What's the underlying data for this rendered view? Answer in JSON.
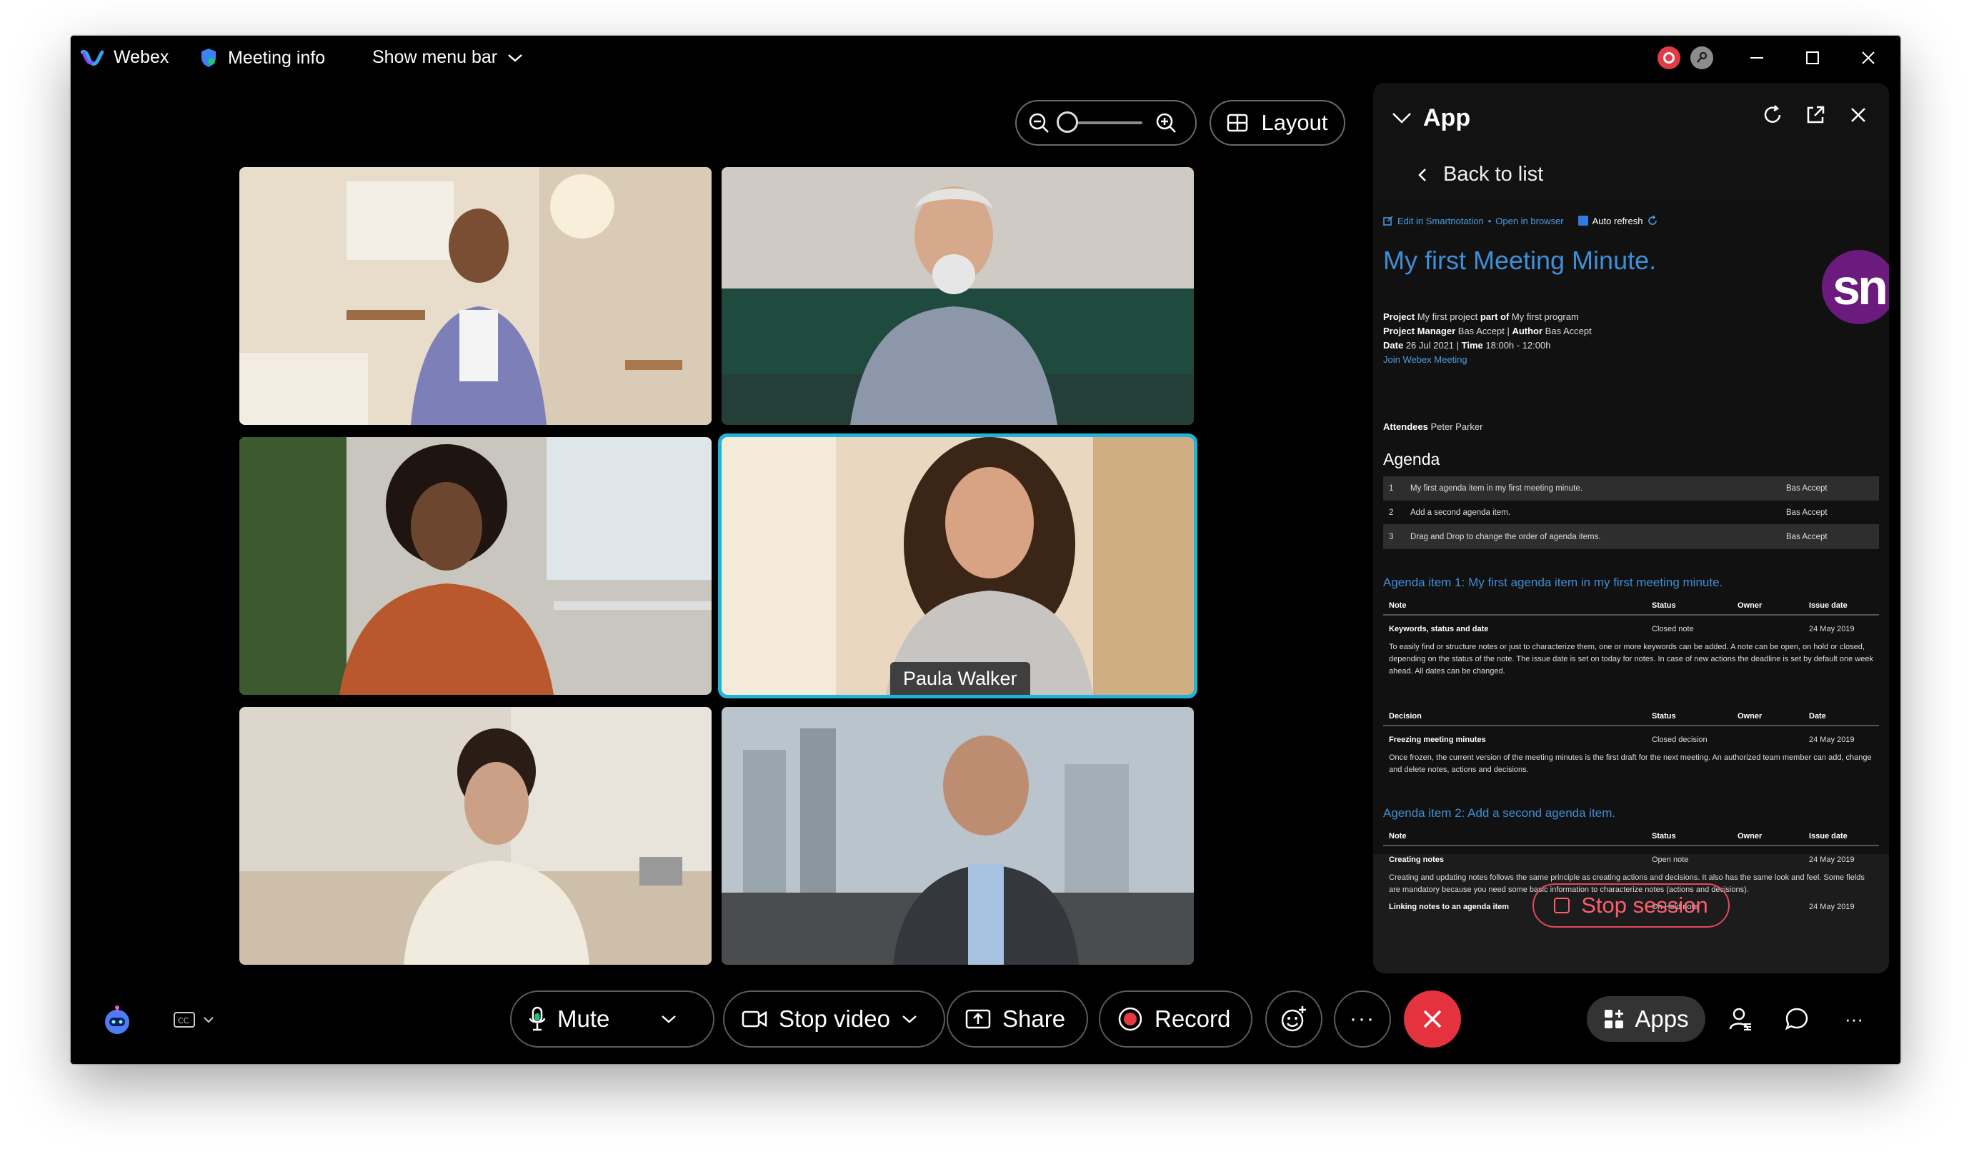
{
  "titlebar": {
    "app_name": "Webex",
    "meeting_info": "Meeting info",
    "show_menu_bar": "Show menu bar"
  },
  "toolbar": {
    "layout_label": "Layout"
  },
  "participants": [
    {
      "name": ""
    },
    {
      "name": ""
    },
    {
      "name": ""
    },
    {
      "name": "Paula Walker",
      "active": true
    },
    {
      "name": ""
    },
    {
      "name": ""
    }
  ],
  "panel": {
    "title": "App",
    "back_label": "Back to list",
    "doc": {
      "edit_link": "Edit in Smartnotation",
      "separator": "•",
      "open_link": "Open in browser",
      "auto_refresh": "Auto refresh",
      "title": "My first Meeting Minute.",
      "logo_text": "sn",
      "project_label": "Project",
      "project": "My first project",
      "part_of_label": "part of",
      "program": "My first program",
      "pm_label": "Project Manager",
      "pm": "Bas Accept",
      "author_label": "Author",
      "author": "Bas Accept",
      "date_label": "Date",
      "date": "26 Jul 2021",
      "time_label": "Time",
      "time": "18:00h - 12:00h",
      "join_link": "Join Webex Meeting",
      "attendees_label": "Attendees",
      "attendees": "Peter Parker",
      "agenda_heading": "Agenda",
      "agenda_items": [
        {
          "n": "1",
          "title": "My first agenda item in my first meeting minute.",
          "owner": "Bas Accept"
        },
        {
          "n": "2",
          "title": "Add a second agenda item.",
          "owner": "Bas Accept"
        },
        {
          "n": "3",
          "title": "Drag and Drop to change the order of agenda items.",
          "owner": "Bas Accept"
        }
      ],
      "item1_heading": "Agenda item 1: My first agenda item in my first meeting minute.",
      "item1_note_headers": [
        "Note",
        "Status",
        "Owner",
        "Issue date"
      ],
      "item1_note": {
        "title": "Keywords, status and date",
        "status": "Closed note",
        "owner": "",
        "date": "24 May 2019",
        "desc": "To easily find or structure notes or just to characterize them, one or more keywords can be added. A note can be open, on hold or closed, depending on the status of the note. The issue date is set on today for notes. In case of new actions the deadline is set by default one week ahead. All dates can be changed."
      },
      "item1_decision_headers": [
        "Decision",
        "Status",
        "Owner",
        "Date"
      ],
      "item1_decision": {
        "title": "Freezing meeting minutes",
        "status": "Closed decision",
        "owner": "",
        "date": "24 May 2019",
        "desc": "Once frozen, the current version of the meeting minutes is the first draft for the next meeting. An authorized team member can add, change and delete notes, actions and decisions."
      },
      "item2_heading": "Agenda item 2: Add a second agenda item.",
      "item2_note_headers": [
        "Note",
        "Status",
        "Owner",
        "Issue date"
      ],
      "item2_note": {
        "title": "Creating notes",
        "status": "Open note",
        "owner": "",
        "date": "24 May 2019",
        "desc": "Creating and updating notes follows the same principle as creating actions and decisions. It also has the same look and feel. Some fields are mandatory because you need some basic information to characterize notes (actions and decisions)."
      },
      "item2_note2": {
        "title": "Linking notes to an agenda item",
        "status": "On Hold note",
        "owner": "",
        "date": "24 May 2019"
      }
    },
    "stop_session": "Stop session"
  },
  "controls": {
    "mute": "Mute",
    "stop_video": "Stop video",
    "share": "Share",
    "record": "Record",
    "more": "···",
    "apps": "Apps",
    "more_right": "···"
  },
  "colors": {
    "accent": "#1fb4d9",
    "end_call": "#e5323f",
    "link": "#3f8fd8",
    "record": "#e23b46"
  }
}
